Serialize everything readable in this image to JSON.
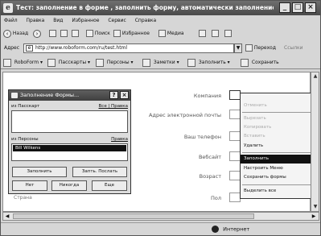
{
  "window": {
    "title": "Тест: заполнение в форме , заполнить форму, автоматически заполнение"
  },
  "menu": [
    "Файл",
    "Правка",
    "Вид",
    "Избранное",
    "Сервис",
    "Справка"
  ],
  "nav": {
    "back": "Назад",
    "search": "Поиск",
    "favorites": "Избранное",
    "media": "Медиа"
  },
  "address": {
    "label": "Адрес",
    "url": "http://www.roboform.com/ru/test.html",
    "go": "Переход",
    "links": "Ссылки"
  },
  "roboform_bar": {
    "brand": "RoboForm",
    "passcards": "Пасскарты",
    "identities": "Персоны",
    "notes": "Заметки",
    "fill": "Заполнить",
    "save": "Сохранить"
  },
  "form": {
    "fields": [
      "Компания",
      "Адрес электронной почты",
      "Ваш телефон",
      "Вебсайт",
      "Возраст",
      "Пол"
    ]
  },
  "dialog": {
    "title": "Заполнение Формы...",
    "passcards_label": "из Пасскарт",
    "all_passcards": "Все | Правка",
    "identities_label": "из Персоны",
    "edit": "Правка",
    "selected_identity": "Bill Wilkens",
    "btn_fill": "Заполнить",
    "btn_fill_submit": "Запть. Послать",
    "btn_no": "Нет",
    "btn_never": "Никогда",
    "btn_more": "Еще"
  },
  "page_link": "Страна",
  "context_menu": [
    {
      "label": "Отменить",
      "state": "disabled"
    },
    {
      "label": "Вырезать",
      "state": "disabled"
    },
    {
      "label": "Копировать",
      "state": "disabled"
    },
    {
      "label": "Вставить",
      "state": "disabled"
    },
    {
      "label": "Удалить",
      "state": "normal"
    },
    {
      "label": "Заполнить",
      "state": "highlighted"
    },
    {
      "label": "Настроить Меню",
      "state": "normal"
    },
    {
      "label": "Сохранить формы",
      "state": "normal"
    },
    {
      "label": "Выделить все",
      "state": "normal"
    }
  ],
  "status": {
    "zone": "Интернет"
  }
}
